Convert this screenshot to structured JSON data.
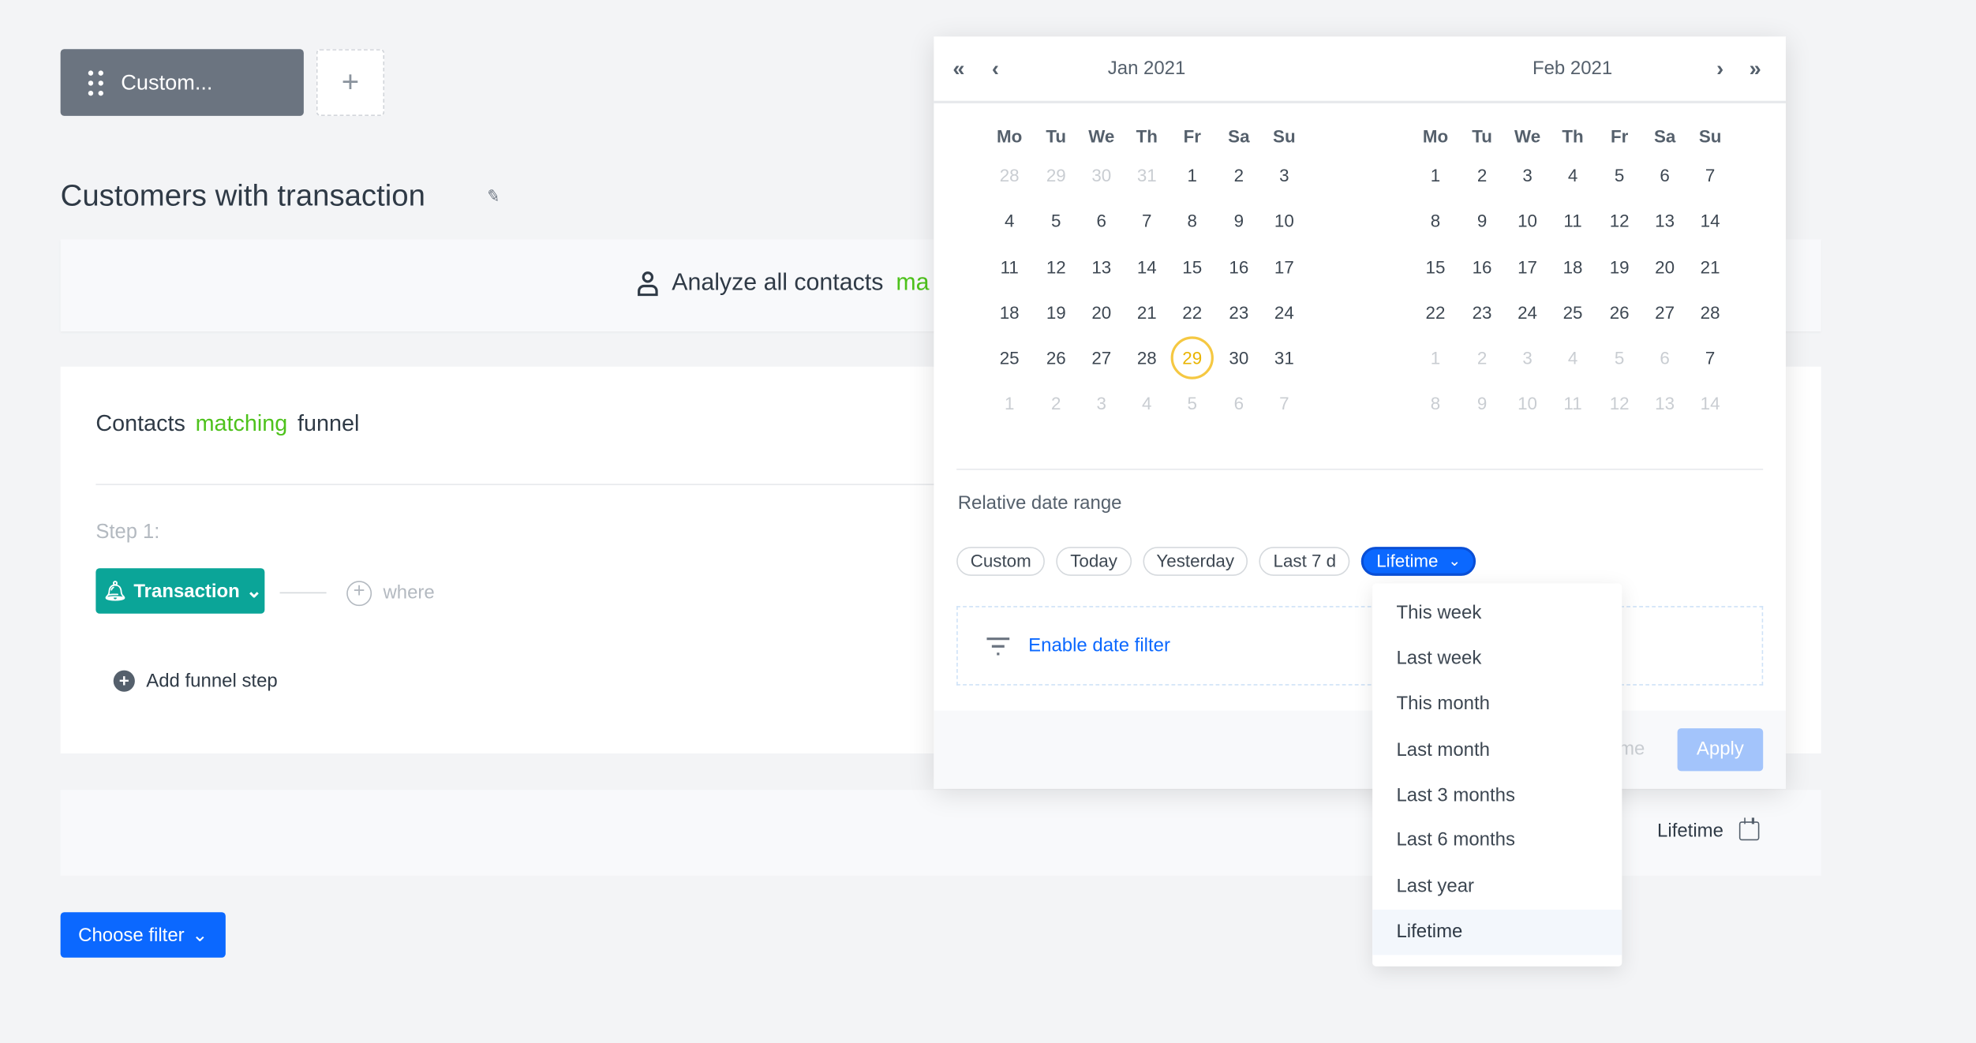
{
  "tabs": {
    "active_label": "Custom...",
    "add_label": "+"
  },
  "title": "Customers with transaction",
  "analyze": {
    "text": "Analyze all contacts",
    "highlight": "ma"
  },
  "funnel": {
    "prefix": "Contacts",
    "highlight": "matching",
    "suffix": "funnel",
    "step_label": "Step 1:",
    "event": "Transaction",
    "where": "where",
    "add_step": "Add funnel step"
  },
  "range_bar": {
    "label": "Lifetime"
  },
  "choose_filter": "Choose filter",
  "datepicker": {
    "weekdays": [
      "Mo",
      "Tu",
      "We",
      "Th",
      "Fr",
      "Sa",
      "Su"
    ],
    "months": [
      {
        "title": "Jan 2021",
        "weeks": [
          [
            28,
            29,
            30,
            31,
            1,
            2,
            3
          ],
          [
            4,
            5,
            6,
            7,
            8,
            9,
            10
          ],
          [
            11,
            12,
            13,
            14,
            15,
            16,
            17
          ],
          [
            18,
            19,
            20,
            21,
            22,
            23,
            24
          ],
          [
            25,
            26,
            27,
            28,
            29,
            30,
            31
          ],
          [
            1,
            2,
            3,
            4,
            5,
            6,
            7
          ]
        ]
      },
      {
        "title": "Feb 2021",
        "weeks": [
          [
            1,
            2,
            3,
            4,
            5,
            6,
            7
          ],
          [
            8,
            9,
            10,
            11,
            12,
            13,
            14
          ],
          [
            15,
            16,
            17,
            18,
            19,
            20,
            21
          ],
          [
            22,
            23,
            24,
            25,
            26,
            27,
            28
          ],
          [
            1,
            2,
            3,
            4,
            5,
            6,
            7
          ],
          [
            8,
            9,
            10,
            11,
            12,
            13,
            14
          ]
        ]
      }
    ],
    "today": "Jan 29",
    "relative_label": "Relative date range",
    "chips": [
      "Custom",
      "Today",
      "Yesterday",
      "Last 7 d"
    ],
    "selected_chip": "Lifetime",
    "enable_filter": "Enable date filter",
    "footer_partial": "ime",
    "apply": "Apply"
  },
  "dropdown": {
    "items": [
      "This week",
      "Last week",
      "This month",
      "Last month",
      "Last 3 months",
      "Last 6 months",
      "Last year",
      "Lifetime"
    ],
    "selected": "Lifetime"
  },
  "colors": {
    "primary": "#0b68ff",
    "teal": "#0ba598",
    "green": "#4ec21c",
    "today": "#f5c842"
  }
}
